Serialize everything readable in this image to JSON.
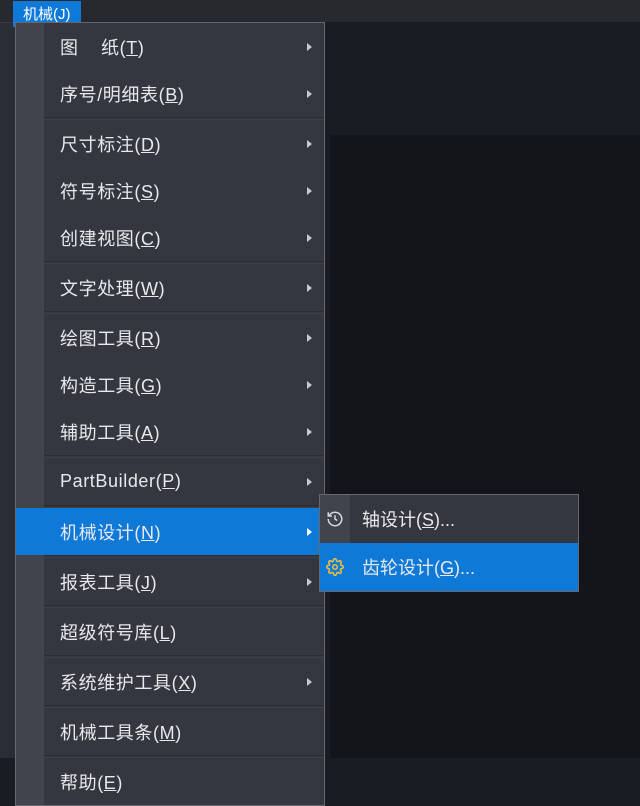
{
  "menuBar": {
    "label_pre": "机械(",
    "label_key": "J",
    "label_post": ")"
  },
  "menu": [
    {
      "type": "item",
      "pre": "图    纸(",
      "key": "T",
      "post": ")",
      "arrow": true
    },
    {
      "type": "item",
      "pre": "序号/明细表(",
      "key": "B",
      "post": ")",
      "arrow": true
    },
    {
      "type": "sep"
    },
    {
      "type": "item",
      "pre": "尺寸标注(",
      "key": "D",
      "post": ")",
      "arrow": true
    },
    {
      "type": "item",
      "pre": "符号标注(",
      "key": "S",
      "post": ")",
      "arrow": true
    },
    {
      "type": "item",
      "pre": "创建视图(",
      "key": "C",
      "post": ")",
      "arrow": true
    },
    {
      "type": "sep"
    },
    {
      "type": "item",
      "pre": "文字处理(",
      "key": "W",
      "post": ")",
      "arrow": true
    },
    {
      "type": "sep"
    },
    {
      "type": "item",
      "pre": "绘图工具(",
      "key": "R",
      "post": ")",
      "arrow": true
    },
    {
      "type": "item",
      "pre": "构造工具(",
      "key": "G",
      "post": ")",
      "arrow": true
    },
    {
      "type": "item",
      "pre": "辅助工具(",
      "key": "A",
      "post": ")",
      "arrow": true
    },
    {
      "type": "sep"
    },
    {
      "type": "item",
      "pre": "PartBuilder(",
      "key": "P",
      "post": ")",
      "arrow": true
    },
    {
      "type": "sep"
    },
    {
      "type": "item",
      "pre": "机械设计(",
      "key": "N",
      "post": ")",
      "arrow": true,
      "selected": true
    },
    {
      "type": "sep"
    },
    {
      "type": "item",
      "pre": "报表工具(",
      "key": "J",
      "post": ")",
      "arrow": true
    },
    {
      "type": "sep"
    },
    {
      "type": "item",
      "pre": "超级符号库(",
      "key": "L",
      "post": ")",
      "arrow": false
    },
    {
      "type": "sep"
    },
    {
      "type": "item",
      "pre": "系统维护工具(",
      "key": "X",
      "post": ")",
      "arrow": true
    },
    {
      "type": "sep"
    },
    {
      "type": "item",
      "pre": "机械工具条(",
      "key": "M",
      "post": ")",
      "arrow": false
    },
    {
      "type": "sep"
    },
    {
      "type": "item",
      "pre": "帮助(",
      "key": "E",
      "post": ")",
      "arrow": false
    }
  ],
  "submenu": [
    {
      "icon": "history-icon",
      "pre": "轴设计(",
      "key": "S",
      "post": ")...",
      "selected": false
    },
    {
      "icon": "gear-icon",
      "pre": "齿轮设计(",
      "key": "G",
      "post": ")...",
      "selected": true
    }
  ]
}
